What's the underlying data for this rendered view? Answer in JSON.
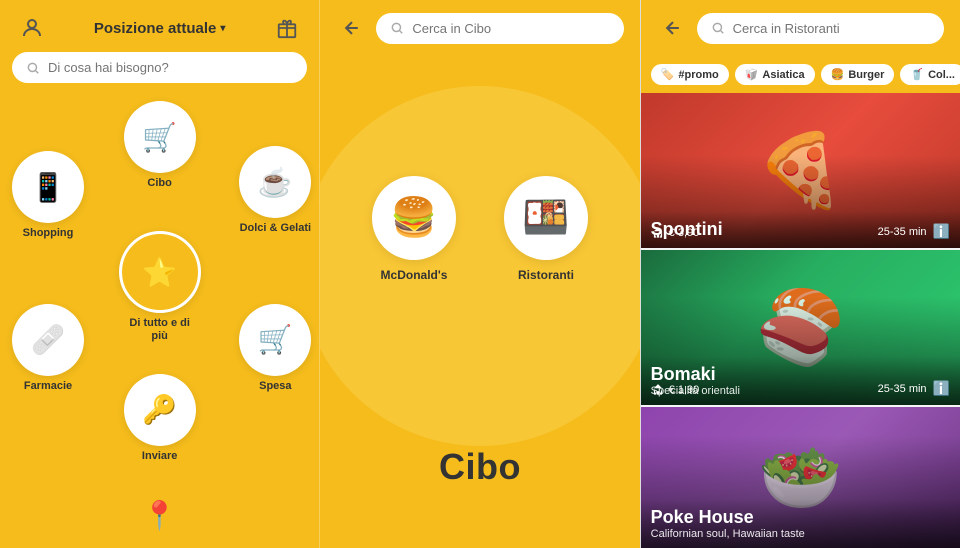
{
  "panels": {
    "panel1": {
      "header": {
        "title": "Posizione attuale",
        "chevron": "▾",
        "avatar_icon": "👤",
        "gift_icon": "🎁"
      },
      "search": {
        "placeholder": "Di cosa hai bisogno?"
      },
      "menu_items": [
        {
          "id": "cibo",
          "label": "Cibo",
          "icon": "🛒",
          "position": "top"
        },
        {
          "id": "shopping",
          "label": "Shopping",
          "icon": "📱",
          "position": "left"
        },
        {
          "id": "dolci",
          "label": "Dolci & Gelati",
          "icon": "☕",
          "position": "top-right"
        },
        {
          "id": "tutto",
          "label": "Di tutto e di più",
          "icon": "✨",
          "position": "center"
        },
        {
          "id": "farmacie",
          "label": "Farmacie",
          "icon": "🩹",
          "position": "bottom-left"
        },
        {
          "id": "spesa",
          "label": "Spesa",
          "icon": "🛒",
          "position": "bottom-right"
        },
        {
          "id": "inviare",
          "label": "Inviare",
          "icon": "🔑",
          "position": "bottom"
        }
      ],
      "pin_icon": "📍"
    },
    "panel2": {
      "search": {
        "placeholder": "Cerca in Cibo"
      },
      "category_label": "Cibo",
      "food_items": [
        {
          "id": "mcdonalds",
          "label": "McDonald's",
          "icon": "🍔"
        },
        {
          "id": "ristoranti",
          "label": "Ristoranti",
          "icon": "🍱"
        }
      ]
    },
    "panel3": {
      "search": {
        "placeholder": "Cerca in Ristoranti"
      },
      "filter_tags": [
        {
          "id": "promo",
          "label": "#promo",
          "icon": "🏷️"
        },
        {
          "id": "asiatica",
          "label": "Asiatica",
          "icon": "🥡"
        },
        {
          "id": "burger",
          "label": "Burger",
          "icon": "🍔"
        },
        {
          "id": "cola",
          "label": "Col...",
          "icon": "🥤"
        }
      ],
      "restaurants": [
        {
          "id": "spontini",
          "name": "Spontini",
          "subtitle": "",
          "delivery_cost": "€ 3,90",
          "time": "25-35 min",
          "bg_color": "#c0392b",
          "food_emoji": "🍕"
        },
        {
          "id": "bomaki",
          "name": "Bomaki",
          "subtitle": "Specialità orientali",
          "delivery_cost": "€ 1,90",
          "time": "25-35 min",
          "bg_color": "#1a6b3c",
          "food_emoji": "🍣"
        },
        {
          "id": "poke-house",
          "name": "Poke House",
          "subtitle": "Californian soul, Hawaiian taste",
          "delivery_cost": "",
          "time": "",
          "bg_color": "#8e44ad",
          "food_emoji": "🥗"
        }
      ]
    }
  }
}
